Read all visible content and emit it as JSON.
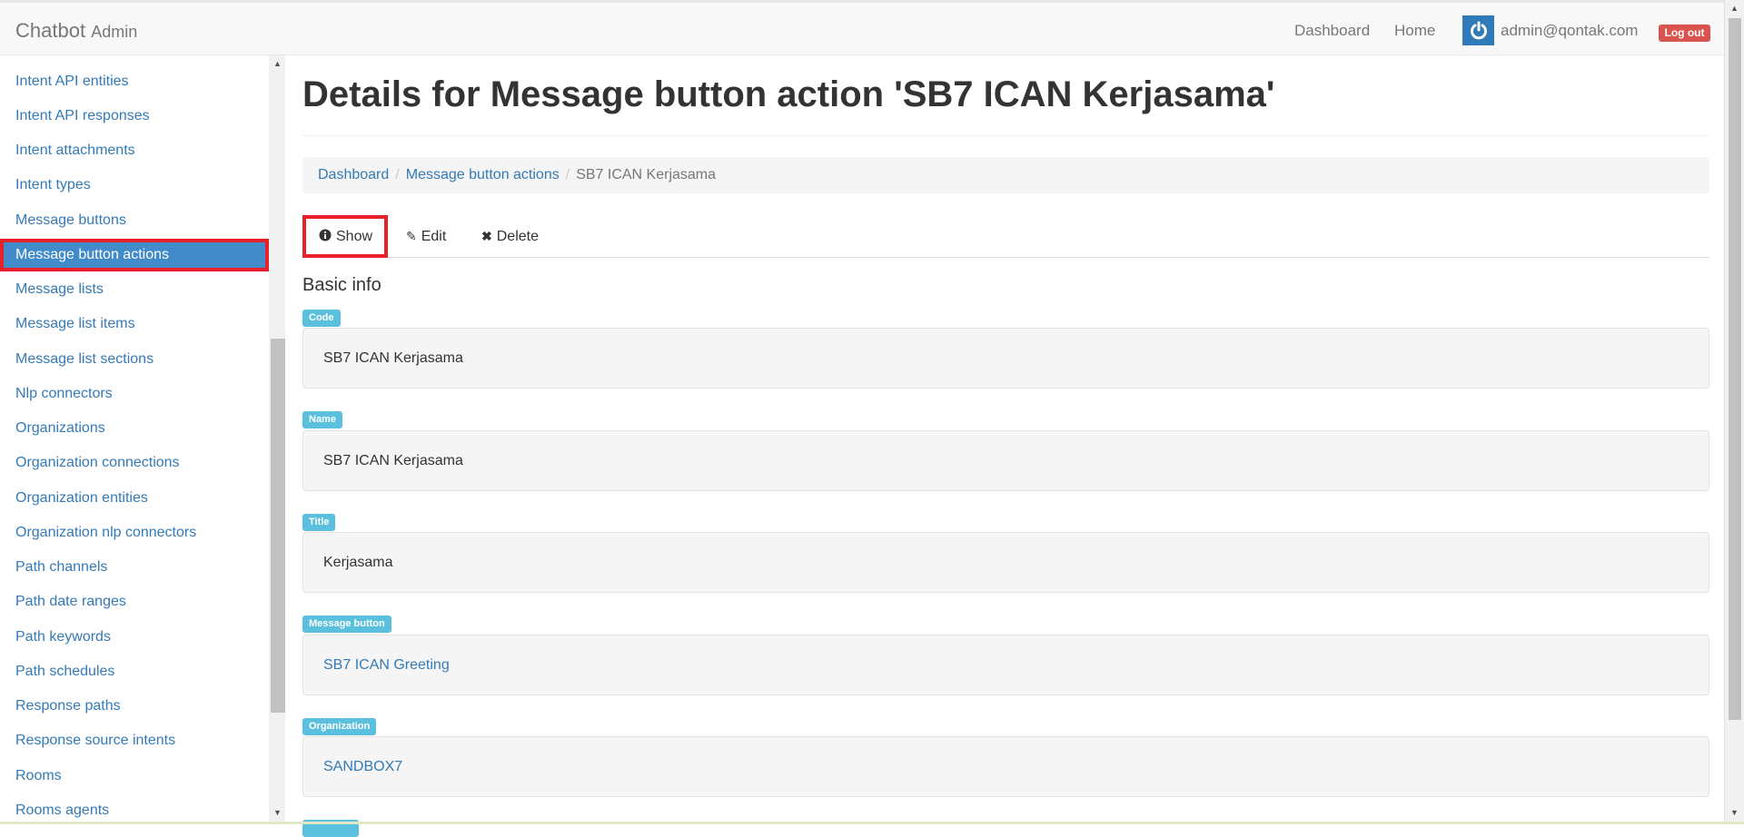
{
  "navbar": {
    "brand": "Chatbot",
    "brand_sub": "Admin",
    "links": [
      "Dashboard",
      "Home"
    ],
    "user_email": "admin@qontak.com",
    "logout": "Log out"
  },
  "sidebar": {
    "items": [
      {
        "label": "Intent API entities"
      },
      {
        "label": "Intent API responses"
      },
      {
        "label": "Intent attachments"
      },
      {
        "label": "Intent types"
      },
      {
        "label": "Message buttons"
      },
      {
        "label": "Message button actions",
        "active": true
      },
      {
        "label": "Message lists"
      },
      {
        "label": "Message list items"
      },
      {
        "label": "Message list sections"
      },
      {
        "label": "Nlp connectors"
      },
      {
        "label": "Organizations"
      },
      {
        "label": "Organization connections"
      },
      {
        "label": "Organization entities"
      },
      {
        "label": "Organization nlp connectors"
      },
      {
        "label": "Path channels"
      },
      {
        "label": "Path date ranges"
      },
      {
        "label": "Path keywords"
      },
      {
        "label": "Path schedules"
      },
      {
        "label": "Response paths"
      },
      {
        "label": "Response source intents"
      },
      {
        "label": "Rooms"
      },
      {
        "label": "Rooms agents"
      }
    ]
  },
  "main": {
    "title": "Details for Message button action 'SB7 ICAN Kerjasama'",
    "breadcrumb": {
      "dashboard": "Dashboard",
      "section": "Message button actions",
      "current": "SB7 ICAN Kerjasama"
    },
    "tabs": {
      "show": "Show",
      "edit": "Edit",
      "delete": "Delete"
    },
    "section_title": "Basic info",
    "fields": [
      {
        "label": "Code",
        "value": "SB7 ICAN Kerjasama"
      },
      {
        "label": "Name",
        "value": "SB7 ICAN Kerjasama"
      },
      {
        "label": "Title",
        "value": "Kerjasama"
      },
      {
        "label": "Message button",
        "value": "SB7 ICAN Greeting"
      },
      {
        "label": "Organization",
        "value": "SANDBOX7"
      }
    ]
  },
  "icons": {
    "info": "info-circle-icon",
    "edit": "pencil-icon",
    "delete": "times-icon",
    "user": "power-icon"
  },
  "colors": {
    "link": "#337ab7",
    "active_bg": "#428bca",
    "label_bg": "#5bc0de",
    "highlight_border": "#e8202a",
    "logout_bg": "#d9534f"
  }
}
